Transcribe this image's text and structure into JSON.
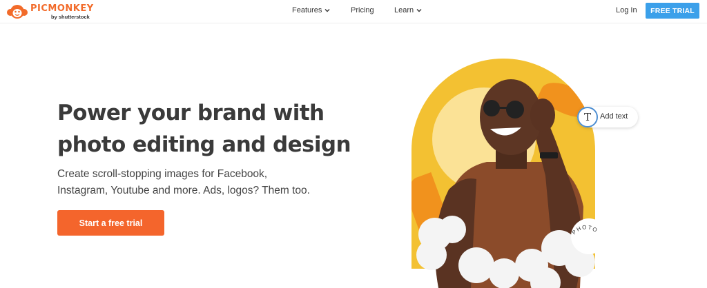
{
  "brand": {
    "name": "PICMONKEY",
    "byline": "by shutterstock",
    "accent": "#f26b2a",
    "trial_blue": "#3ba0ea",
    "cta_orange": "#f4652c"
  },
  "nav": {
    "items": [
      {
        "label": "Features",
        "has_dropdown": true,
        "icon": "chevron-down-icon"
      },
      {
        "label": "Pricing",
        "has_dropdown": false
      },
      {
        "label": "Learn",
        "has_dropdown": true,
        "icon": "chevron-down-icon"
      }
    ],
    "login_label": "Log In",
    "trial_label": "FREE TRIAL"
  },
  "hero": {
    "headline_line1": "Power your brand with",
    "headline_line2": "photo editing and design",
    "subtext_line1": "Create scroll-stopping images for Facebook,",
    "subtext_line2": "Instagram, Youtube and more. Ads, logos? Them too.",
    "cta_label": "Start a free trial"
  },
  "art": {
    "add_text_icon": "T",
    "add_text_label": "Add text",
    "sticker_text": "PHOTO"
  }
}
